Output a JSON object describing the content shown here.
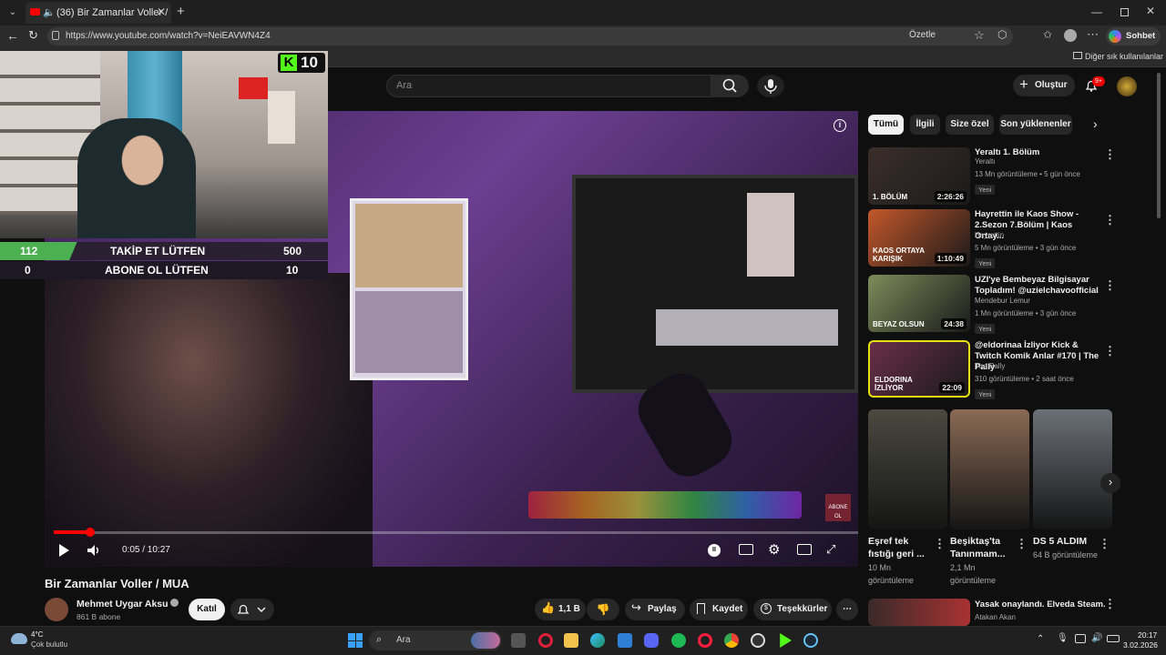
{
  "browser": {
    "tab_title": "(36) Bir Zamanlar Voller / MUA",
    "url": "https://www.youtube.com/watch?v=NeiEAVWN4Z4",
    "summarize": "Özetle",
    "chat": "Sohbet et",
    "other_bookmarks": "Diğer sık kullanılanlar"
  },
  "youtube": {
    "search_placeholder": "Ara",
    "create_label": "Oluştur",
    "notif_count": "9+"
  },
  "overlay": {
    "kick_count": "10",
    "follow_label": "TAKİP ET LÜTFEN",
    "follow_current": "112",
    "follow_goal": "500",
    "follow_fraction": 0.224,
    "sub_label": "ABONE OL LÜTFEN",
    "sub_current": "0",
    "sub_goal": "10"
  },
  "player": {
    "time": "0:05 / 10:27",
    "progress_fraction": 0.008,
    "corner_tag": "ABONE OL"
  },
  "video": {
    "title": "Bir Zamanlar Voller / MUA",
    "channel": "Mehmet Uygar Aksu",
    "subscribers": "861 B abone",
    "join": "Katıl",
    "likes": "1,1 B",
    "share": "Paylaş",
    "save": "Kaydet",
    "thanks": "Teşekkürler"
  },
  "chips": [
    "Tümü",
    "İlgili",
    "Size özel",
    "Son yüklenenler"
  ],
  "related": [
    {
      "title": "Yeraltı 1. Bölüm",
      "channel": "Yeraltı",
      "meta": "13 Mn görüntüleme • 5 gün önce",
      "duration": "2:26:26",
      "badge": "Yeni",
      "thumb_text": "1. BÖLÜM",
      "color": "#3b2e2a"
    },
    {
      "title": "Hayrettin ile Kaos Show - 2.Sezon 7.Bölüm | Kaos Ortay...",
      "channel": "Hayrettin",
      "meta": "5 Mn görüntüleme • 3 gün önce",
      "duration": "1:10:49",
      "badge": "Yeni",
      "thumb_text": "KAOS ORTAYA KARIŞIK",
      "color": "#c4572a"
    },
    {
      "title": "UZI'ye Bembeyaz Bilgisayar Topladım! @uzielchavoofficial",
      "channel": "Mendebur Lemur",
      "meta": "1 Mn görüntüleme • 3 gün önce",
      "duration": "24:38",
      "badge": "Yeni",
      "thumb_text": "BEYAZ OLSUN",
      "color": "#7d8c5a"
    },
    {
      "title": "@eldorinaa İzliyor Kick & Twitch Komik Anlar #170 | The Pally",
      "channel": "The Pally",
      "meta": "310 görüntüleme • 2 saat önce",
      "duration": "22:09",
      "badge": "Yeni",
      "thumb_text": "ELDORINA İZLİYOR",
      "color": "#6a2e4a"
    }
  ],
  "shorts": [
    {
      "title": "Eşref tek fıstığı geri ...",
      "views": "10 Mn görüntüleme",
      "color": "#4a4a40"
    },
    {
      "title": "Beşiktaş'ta Tanınmam...",
      "views": "2,1 Mn görüntüleme",
      "color": "#8a6a55"
    },
    {
      "title": "DS 5 ALDIM",
      "views": "64 B görüntüleme",
      "color": "#6b7078"
    }
  ],
  "next_item": {
    "title": "Yasak onaylandı. Elveda Steam.",
    "channel": "Atakan Akan"
  },
  "taskbar": {
    "temp": "4°C",
    "weather": "Çok bulutlu",
    "search": "Ara",
    "time": "20:17",
    "date": "3.02.2026"
  }
}
